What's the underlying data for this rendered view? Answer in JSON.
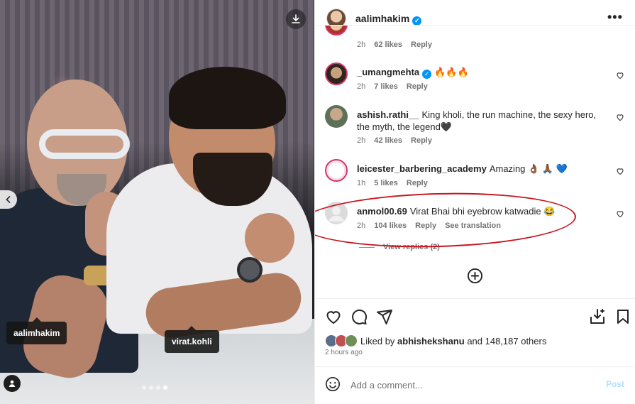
{
  "post": {
    "author": "aalimhakim",
    "tags": [
      "aalimhakim",
      "virat.kohli"
    ],
    "carousel": {
      "count": 4,
      "active_index": 3
    }
  },
  "header": {
    "more_glyph": "•••"
  },
  "comments": [
    {
      "username": "",
      "text": "",
      "time": "2h",
      "likes": "62 likes",
      "reply": "Reply",
      "translate": ""
    },
    {
      "username": "_umangmehta",
      "verified": true,
      "text": "🔥🔥🔥",
      "time": "2h",
      "likes": "7 likes",
      "reply": "Reply",
      "translate": ""
    },
    {
      "username": "ashish.rathi__",
      "text": "King kholi, the run machine, the sexy hero, the myth, the legend🖤",
      "time": "2h",
      "likes": "42 likes",
      "reply": "Reply",
      "translate": ""
    },
    {
      "username": "leicester_barbering_academy",
      "text": "Amazing 👌🏾 🙏🏾 💙",
      "time": "1h",
      "likes": "5 likes",
      "reply": "Reply",
      "translate": ""
    },
    {
      "username": "anmol00.69",
      "text": "Virat Bhai bhi eyebrow katwadie 😂",
      "time": "2h",
      "likes": "104 likes",
      "reply": "Reply",
      "translate": "See translation"
    }
  ],
  "view_replies": "View replies (2)",
  "likes": {
    "prefix": "Liked by",
    "user": "abhishekshanu",
    "suffix": "and 148,187 others"
  },
  "timestamp": "2 hours ago",
  "add_comment": {
    "placeholder": "Add a comment...",
    "post_label": "Post"
  },
  "colors": {
    "accent": "#0095f6",
    "annotation_red": "#c8141e",
    "muted": "#737373"
  },
  "icons": [
    "download-icon",
    "chevron-left-icon",
    "user-tag-icon",
    "verified-icon",
    "more-icon",
    "heart-icon",
    "add-circle-icon",
    "comment-icon",
    "share-icon",
    "save-icon",
    "insights-icon",
    "emoji-icon"
  ]
}
